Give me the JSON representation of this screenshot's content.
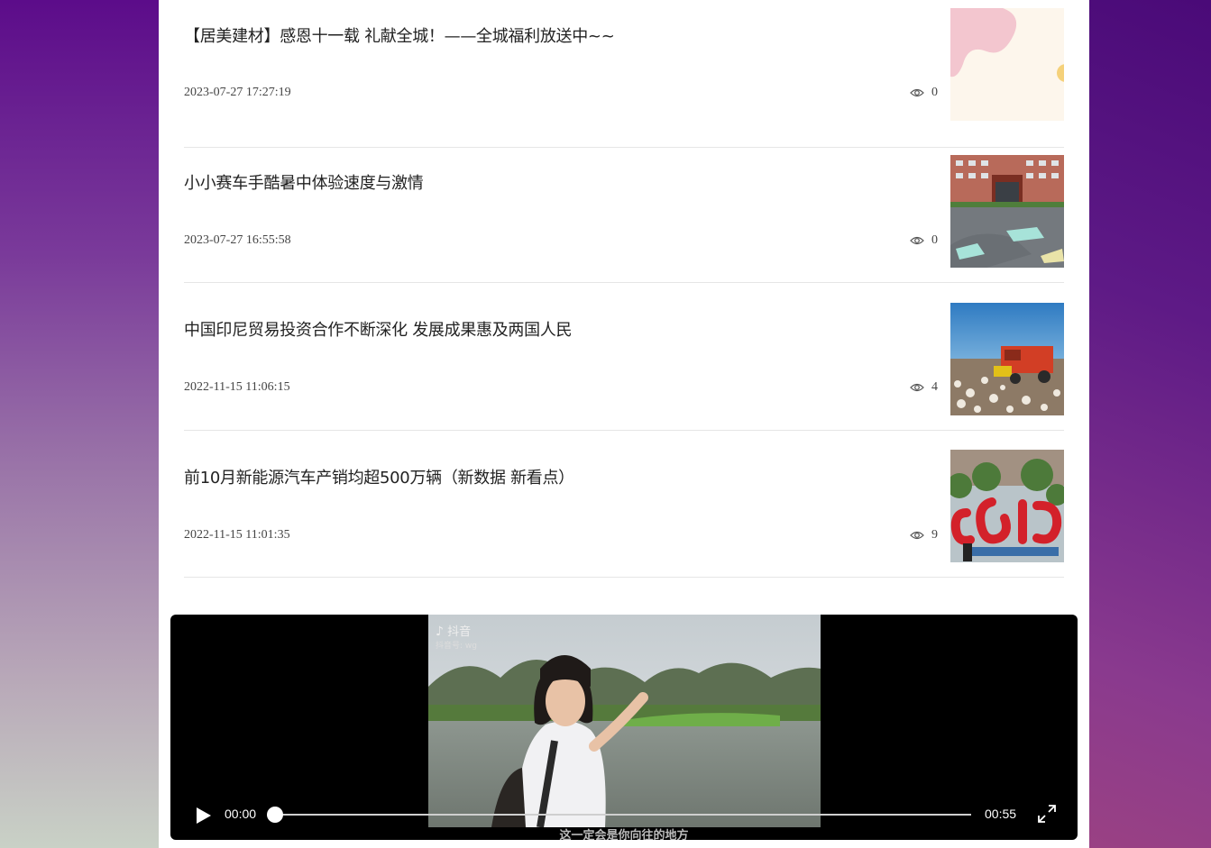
{
  "news": [
    {
      "title": "【居美建材】感恩十一载 礼献全城！——全城福利放送中~~",
      "date": "2023-07-27 17:27:19",
      "views": "0",
      "thumb_icon": "abstract-pink-image"
    },
    {
      "title": "小小赛车手酷暑中体验速度与激情",
      "date": "2023-07-27 16:55:58",
      "views": "0",
      "thumb_icon": "building-track-image"
    },
    {
      "title": "中国印尼贸易投资合作不断深化 发展成果惠及两国人民",
      "date": "2022-11-15 11:06:15",
      "views": "4",
      "thumb_icon": "cotton-harvester-image"
    },
    {
      "title": "前10月新能源汽车产销均超500万辆（新数据 新看点）",
      "date": "2022-11-15 11:01:35",
      "views": "9",
      "thumb_icon": "balloon-letters-image"
    }
  ],
  "video": {
    "current_time": "00:00",
    "duration": "00:55",
    "progress": 0,
    "watermark": "抖音",
    "watermark_id": "抖音号: wg",
    "subtitle": "这一定会是你向往的地方"
  }
}
